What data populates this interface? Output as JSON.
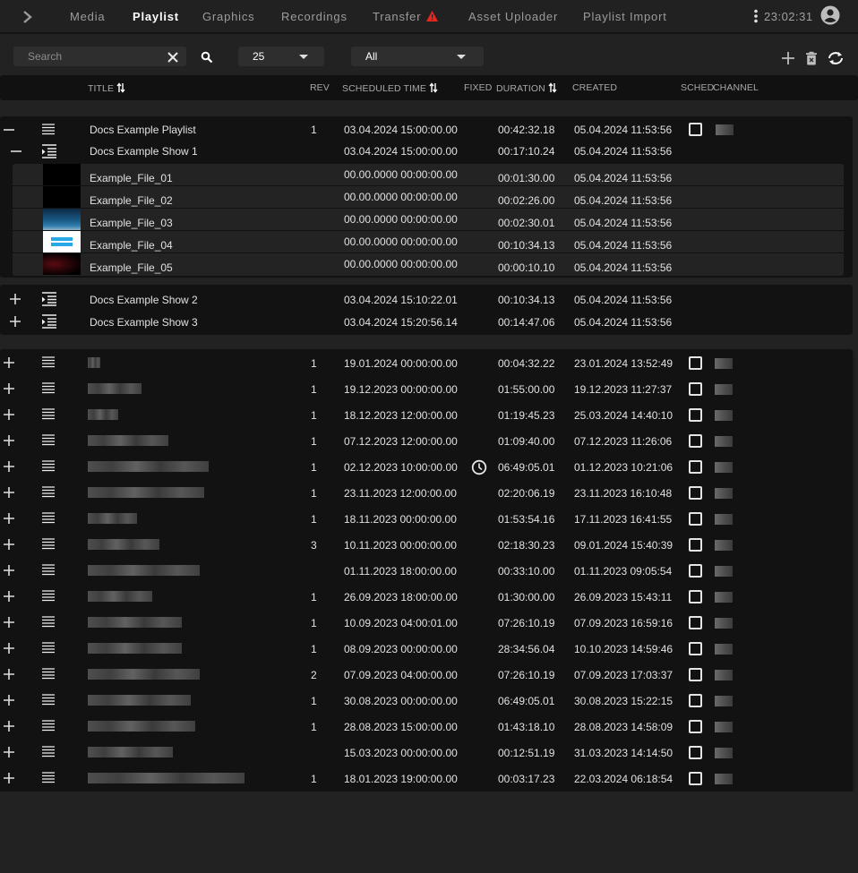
{
  "nav": {
    "tabs": [
      {
        "label": "Media",
        "active": false
      },
      {
        "label": "Playlist",
        "active": true
      },
      {
        "label": "Graphics",
        "active": false
      },
      {
        "label": "Recordings",
        "active": false
      },
      {
        "label": "Transfer",
        "active": false,
        "warning": true
      },
      {
        "label": "Asset Uploader",
        "active": false
      },
      {
        "label": "Playlist Import",
        "active": false
      }
    ],
    "clock": "23:02:31",
    "icons": {
      "expand": "chevron-right-icon",
      "warning": "warning-triangle-icon",
      "menu": "kebab-menu-icon",
      "user": "account-circle-icon"
    },
    "warning_color": "#e8261d"
  },
  "toolbar": {
    "search": {
      "placeholder": "Search",
      "value": ""
    },
    "page_size": {
      "selected": "25"
    },
    "filter": {
      "selected": "All"
    },
    "actions": [
      {
        "name": "add",
        "icon": "plus-icon"
      },
      {
        "name": "delete",
        "icon": "trash-icon"
      },
      {
        "name": "refresh",
        "icon": "sync-icon"
      }
    ]
  },
  "columns": {
    "title": "TITLE",
    "rev": "REV",
    "scheduled_time": "SCHEDULED TIME",
    "fixed": "FIXED",
    "duration": "DURATION",
    "created": "CREATED",
    "sched": "SCHED",
    "channel": "CHANNEL"
  },
  "expanded_playlist": {
    "title": "Docs Example Playlist",
    "rev": "1",
    "scheduled_time": "03.04.2024 15:00:00.00",
    "duration": "00:42:32.18",
    "created": "05.04.2024 11:53:56",
    "sched": false,
    "channel": "[blurred]",
    "shows": [
      {
        "title": "Docs Example Show 1",
        "expanded": true,
        "scheduled_time": "03.04.2024 15:00:00.00",
        "duration": "00:17:10.24",
        "created": "05.04.2024 11:53:56",
        "files": [
          {
            "title": "Example_File_01",
            "scheduled_time": "00.00.0000 00:00:00.00",
            "duration": "00:01:30.00",
            "created": "05.04.2024 11:53:56",
            "thumb": "black"
          },
          {
            "title": "Example_File_02",
            "scheduled_time": "00.00.0000 00:00:00.00",
            "duration": "00:02:26.00",
            "created": "05.04.2024 11:53:56",
            "thumb": "black"
          },
          {
            "title": "Example_File_03",
            "scheduled_time": "00.00.0000 00:00:00.00",
            "duration": "00:02:30.01",
            "created": "05.04.2024 11:53:56",
            "thumb": "blue-sky"
          },
          {
            "title": "Example_File_04",
            "scheduled_time": "00.00.0000 00:00:00.00",
            "duration": "00:10:34.13",
            "created": "05.04.2024 11:53:56",
            "thumb": "big-buck-bunny-logo"
          },
          {
            "title": "Example_File_05",
            "scheduled_time": "00.00.0000 00:00:00.00",
            "duration": "00:00:10.10",
            "created": "05.04.2024 11:53:56",
            "thumb": "dark-red"
          }
        ]
      },
      {
        "title": "Docs Example Show 2",
        "expanded": false,
        "scheduled_time": "03.04.2024 15:10:22.01",
        "duration": "00:10:34.13",
        "created": "05.04.2024 11:53:56"
      },
      {
        "title": "Docs Example Show 3",
        "expanded": false,
        "scheduled_time": "03.04.2024 15:20:56.14",
        "duration": "00:14:47.06",
        "created": "05.04.2024 11:53:56"
      }
    ]
  },
  "playlists": [
    {
      "title": "[blurred]",
      "rev": "1",
      "scheduled_time": "19.01.2024 00:00:00.00",
      "fixed": false,
      "duration": "00:04:32.22",
      "created": "23.01.2024 13:52:49",
      "sched": false,
      "channel": "[blurred]"
    },
    {
      "title": "[blurred]",
      "rev": "1",
      "scheduled_time": "19.12.2023 00:00:00.00",
      "fixed": false,
      "duration": "01:55:00.00",
      "created": "19.12.2023 11:27:37",
      "sched": false,
      "channel": "[blurred]"
    },
    {
      "title": "[blurred]",
      "rev": "1",
      "scheduled_time": "18.12.2023 12:00:00.00",
      "fixed": false,
      "duration": "01:19:45.23",
      "created": "25.03.2024 14:40:10",
      "sched": false,
      "channel": "[blurred]"
    },
    {
      "title": "[blurred]",
      "rev": "1",
      "scheduled_time": "07.12.2023 12:00:00.00",
      "fixed": false,
      "duration": "01:09:40.00",
      "created": "07.12.2023 11:26:06",
      "sched": false,
      "channel": "[blurred]"
    },
    {
      "title": "[blurred]",
      "rev": "1",
      "scheduled_time": "02.12.2023 10:00:00.00",
      "fixed": true,
      "duration": "06:49:05.01",
      "created": "01.12.2023 10:21:06",
      "sched": false,
      "channel": "[blurred]"
    },
    {
      "title": "[blurred]",
      "rev": "1",
      "scheduled_time": "23.11.2023 12:00:00.00",
      "fixed": false,
      "duration": "02:20:06.19",
      "created": "23.11.2023 16:10:48",
      "sched": false,
      "channel": "[blurred]"
    },
    {
      "title": "[blurred]",
      "rev": "1",
      "scheduled_time": "18.11.2023 00:00:00.00",
      "fixed": false,
      "duration": "01:53:54.16",
      "created": "17.11.2023 16:41:55",
      "sched": false,
      "channel": "[blurred]"
    },
    {
      "title": "[blurred]",
      "rev": "3",
      "scheduled_time": "10.11.2023 00:00:00.00",
      "fixed": false,
      "duration": "02:18:30.23",
      "created": "09.01.2024 15:40:39",
      "sched": false,
      "channel": "[blurred]"
    },
    {
      "title": "[blurred]",
      "rev": "",
      "scheduled_time": "01.11.2023 18:00:00.00",
      "fixed": false,
      "duration": "00:33:10.00",
      "created": "01.11.2023 09:05:54",
      "sched": false,
      "channel": "[blurred]"
    },
    {
      "title": "[blurred]",
      "rev": "1",
      "scheduled_time": "26.09.2023 18:00:00.00",
      "fixed": false,
      "duration": "01:30:00.00",
      "created": "26.09.2023 15:43:11",
      "sched": false,
      "channel": "[blurred]"
    },
    {
      "title": "[blurred]",
      "rev": "1",
      "scheduled_time": "10.09.2023 04:00:01.00",
      "fixed": false,
      "duration": "07:26:10.19",
      "created": "07.09.2023 16:59:16",
      "sched": false,
      "channel": "[blurred]"
    },
    {
      "title": "[blurred]",
      "rev": "1",
      "scheduled_time": "08.09.2023 00:00:00.00",
      "fixed": false,
      "duration": "28:34:56.04",
      "created": "10.10.2023 14:59:46",
      "sched": false,
      "channel": "[blurred]"
    },
    {
      "title": "[blurred]",
      "rev": "2",
      "scheduled_time": "07.09.2023 04:00:00.00",
      "fixed": false,
      "duration": "07:26:10.19",
      "created": "07.09.2023 17:03:37",
      "sched": false,
      "channel": "[blurred]"
    },
    {
      "title": "[blurred]",
      "rev": "1",
      "scheduled_time": "30.08.2023 00:00:00.00",
      "fixed": false,
      "duration": "06:49:05.01",
      "created": "30.08.2023 15:22:15",
      "sched": false,
      "channel": "[blurred]"
    },
    {
      "title": "[blurred]",
      "rev": "1",
      "scheduled_time": "28.08.2023 15:00:00.00",
      "fixed": false,
      "duration": "01:43:18.10",
      "created": "28.08.2023 14:58:09",
      "sched": false,
      "channel": "[blurred]"
    },
    {
      "title": "[blurred]",
      "rev": "",
      "scheduled_time": "15.03.2023 00:00:00.00",
      "fixed": false,
      "duration": "00:12:51.19",
      "created": "31.03.2023 14:14:50",
      "sched": false,
      "channel": "[blurred]"
    },
    {
      "title": "[blurred]",
      "rev": "1",
      "scheduled_time": "18.01.2023 19:00:00.00",
      "fixed": false,
      "duration": "00:03:17.23",
      "created": "22.03.2024 06:18:54",
      "sched": false,
      "channel": "[blurred]"
    }
  ]
}
